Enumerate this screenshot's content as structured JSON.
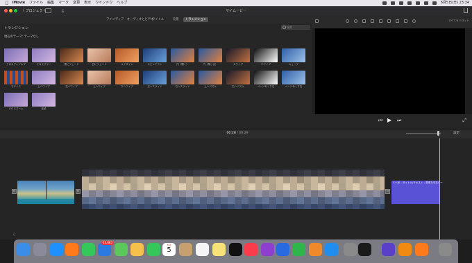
{
  "menubar": {
    "apple": "",
    "app_name": "iMovie",
    "items": [
      "ファイル",
      "編集",
      "マーク",
      "変更",
      "表示",
      "ウインドウ",
      "ヘルプ"
    ],
    "clock": "6月5日(日) 23:34"
  },
  "toolbar": {
    "back_label": "〈 プロジェクト",
    "import_glyph": "↓",
    "window_title": "マイムービー"
  },
  "tabs": [
    "マイメディア",
    "オーディオとビデオ",
    "タイトル",
    "背景",
    "トランジション"
  ],
  "active_tab": "トランジション",
  "browser": {
    "title": "トランジション",
    "search_placeholder": "検索",
    "theme_label": "現在のテーマ: テーマなし",
    "transitions": [
      "クロスディゾルブ",
      "クロスブラー",
      "黒にフェード",
      "白にフェード",
      "ルアズイン",
      "スピンアウト",
      "円（開く）",
      "円（閉じる）",
      "スワイプ",
      "ホワイプ",
      "キューブ",
      "モザイク",
      "上へワイプ",
      "右へワイプ",
      "上へワイプ",
      "下へワイプ",
      "左へスライド",
      "右へスライド",
      "上へパズル",
      "右へパズル",
      "ページめくり左",
      "ページめくり右",
      "クロスズーム",
      "波紋"
    ]
  },
  "viewer": {
    "reset_all": "すべてをリセット",
    "play_glyph": "▶",
    "prev_glyph": "⏮",
    "next_glyph": "⏭",
    "fullscreen_glyph": "⤢"
  },
  "timeline": {
    "current_time": "00:28",
    "separator": "/",
    "total_time": "00:29",
    "settings_label": "設定",
    "title_clip_text": "3.0 秒 – タイトル/テキスト – 簡単な中古グー",
    "transition_marker": "⋈"
  },
  "dock": {
    "mail_badge": "43,083",
    "calendar_month": "6月",
    "calendar_day": "5",
    "apps": [
      "finder-icon",
      "launchpad-icon",
      "safari-icon",
      "firefox-icon",
      "messages-icon",
      "mail-icon",
      "maps-icon",
      "photos-icon",
      "facetime-icon",
      "calendar-icon",
      "contacts-icon",
      "reminders-icon",
      "notes-icon",
      "tv-icon",
      "music-icon",
      "podcasts-icon",
      "keynote-icon",
      "numbers-icon",
      "pages-icon",
      "appstore-icon",
      "settings-icon",
      "terminal-icon",
      "imovie-icon",
      "vlc-icon",
      "firefox-icon",
      "trash-icon"
    ]
  }
}
